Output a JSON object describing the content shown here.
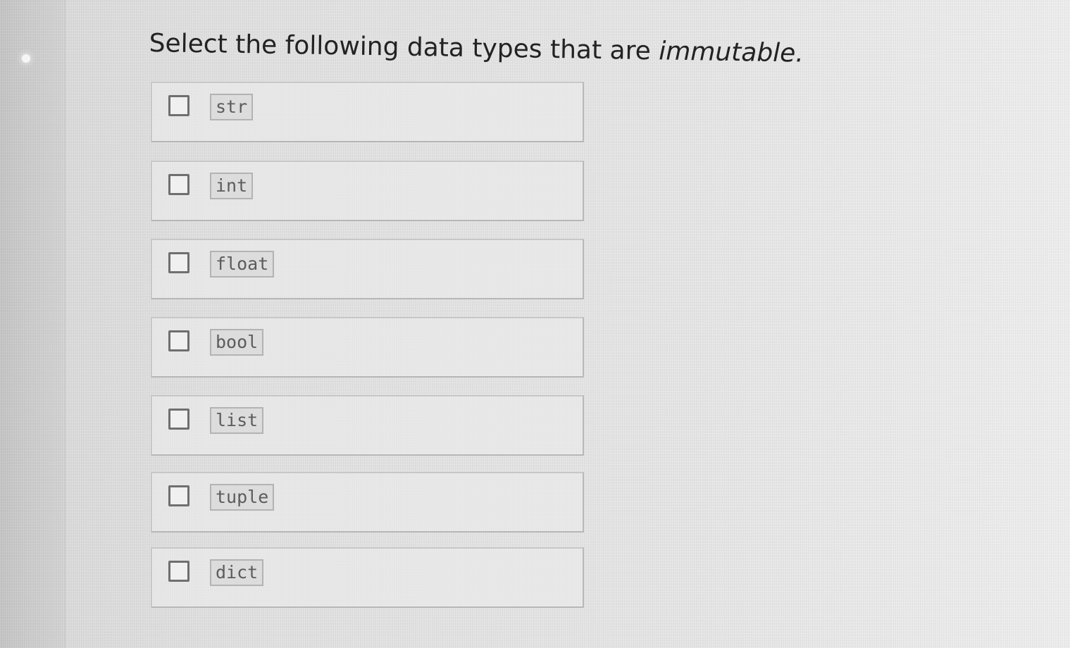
{
  "question": {
    "prefix": "Select the following data types that are ",
    "emphasis": "immutable."
  },
  "options": [
    {
      "label": "str",
      "checked": false
    },
    {
      "label": "int",
      "checked": false
    },
    {
      "label": "float",
      "checked": false
    },
    {
      "label": "bool",
      "checked": false
    },
    {
      "label": "list",
      "checked": false
    },
    {
      "label": "tuple",
      "checked": false
    },
    {
      "label": "dict",
      "checked": false
    }
  ],
  "colors": {
    "text": "#222222",
    "checkbox_border": "#6f6f6f",
    "option_border": "#c7c7c7",
    "code_chip_background": "#d8d8d8"
  }
}
